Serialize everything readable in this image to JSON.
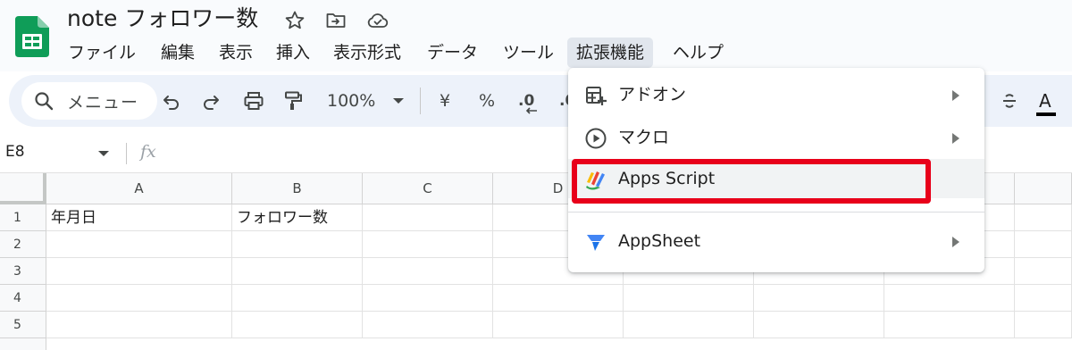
{
  "header": {
    "title": "note フォロワー数",
    "menus": [
      "ファイル",
      "編集",
      "表示",
      "挿入",
      "表示形式",
      "データ",
      "ツール",
      "拡張機能",
      "ヘルプ"
    ]
  },
  "toolbar": {
    "search_label": "メニュー",
    "zoom": "100%",
    "currency": "¥",
    "percent": "%",
    "decimal_label": ".0",
    "decimal_label_2": ".0",
    "text_color_label": "A"
  },
  "formula_bar": {
    "cell_ref": "E8",
    "fx_label": "fx"
  },
  "grid": {
    "columns": [
      "A",
      "B",
      "C",
      "D"
    ],
    "rows": [
      "1",
      "2",
      "3",
      "4",
      "5"
    ],
    "cells": {
      "A1": "年月日",
      "B1": "フォロワー数"
    }
  },
  "extensions_menu": {
    "items": [
      {
        "label": "アドオン",
        "icon": "addon-icon",
        "has_submenu": true
      },
      {
        "label": "マクロ",
        "icon": "play-circle-icon",
        "has_submenu": true
      },
      {
        "label": "Apps Script",
        "icon": "apps-script-icon",
        "has_submenu": false
      },
      {
        "label": "AppSheet",
        "icon": "appsheet-icon",
        "has_submenu": true
      }
    ]
  },
  "colors": {
    "sheets_green": "#0f9d58",
    "highlight_red": "#e8001a",
    "appsheet_blue": "#4285f4"
  }
}
